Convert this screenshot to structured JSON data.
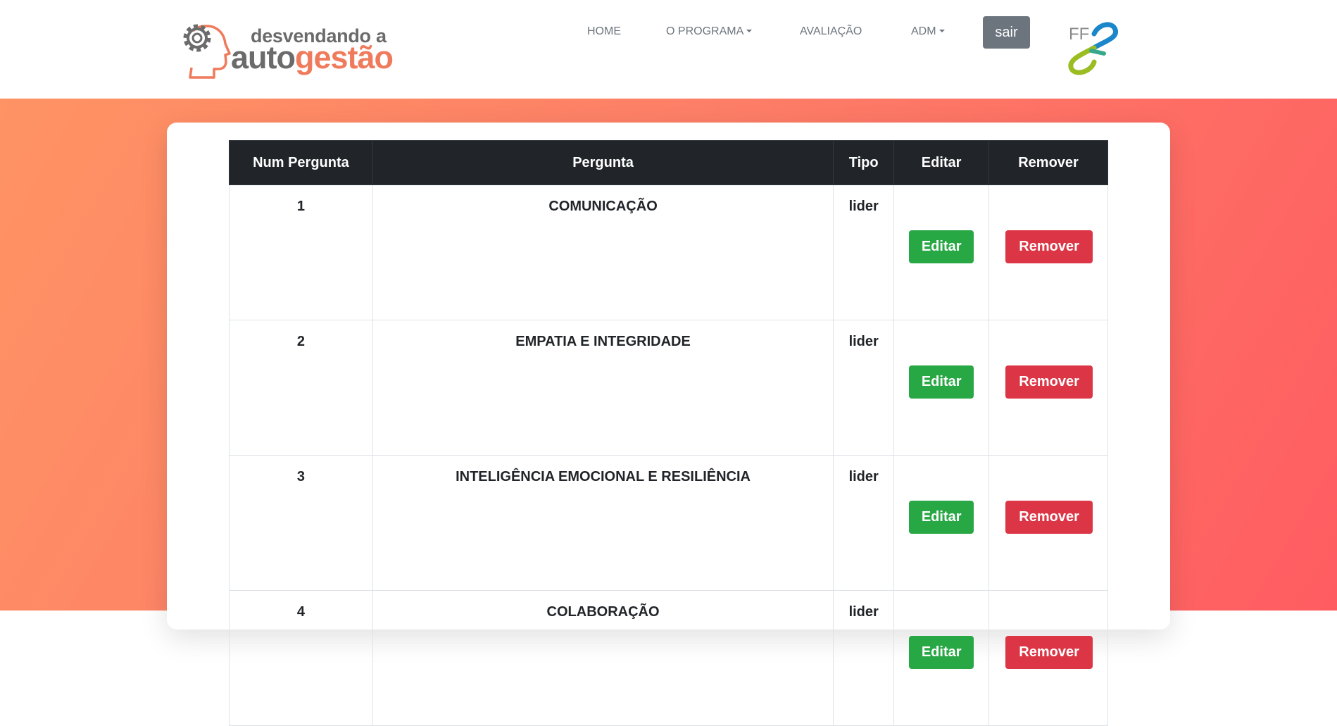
{
  "brand": {
    "line1": "desvendando a",
    "line2_a": "auto",
    "line2_b": "gestão",
    "partner_logo_text": "FF"
  },
  "nav": {
    "home": "HOME",
    "programa": "O PROGRAMA",
    "avaliacao": "AVALIAÇÃO",
    "adm": "ADM",
    "sair": "sair"
  },
  "table": {
    "headers": [
      "Num Pergunta",
      "Pergunta",
      "Tipo",
      "Editar",
      "Remover"
    ],
    "rows": [
      {
        "num": "1",
        "pergunta": "COMUNICAÇÃO",
        "tipo": "lider",
        "edit": "Editar",
        "remove": "Remover"
      },
      {
        "num": "2",
        "pergunta": "EMPATIA E INTEGRIDADE",
        "tipo": "lider",
        "edit": "Editar",
        "remove": "Remover"
      },
      {
        "num": "3",
        "pergunta": "INTELIGÊNCIA EMOCIONAL E RESILIÊNCIA",
        "tipo": "lider",
        "edit": "Editar",
        "remove": "Remover"
      },
      {
        "num": "4",
        "pergunta": "COLABORAÇÃO",
        "tipo": "lider",
        "edit": "Editar",
        "remove": "Remover"
      }
    ]
  },
  "colors": {
    "brand_orange": "#ef7b5c",
    "brand_gray": "#6b6b6b",
    "success": "#28a745",
    "danger": "#dc3545",
    "header_dark": "#212529"
  }
}
